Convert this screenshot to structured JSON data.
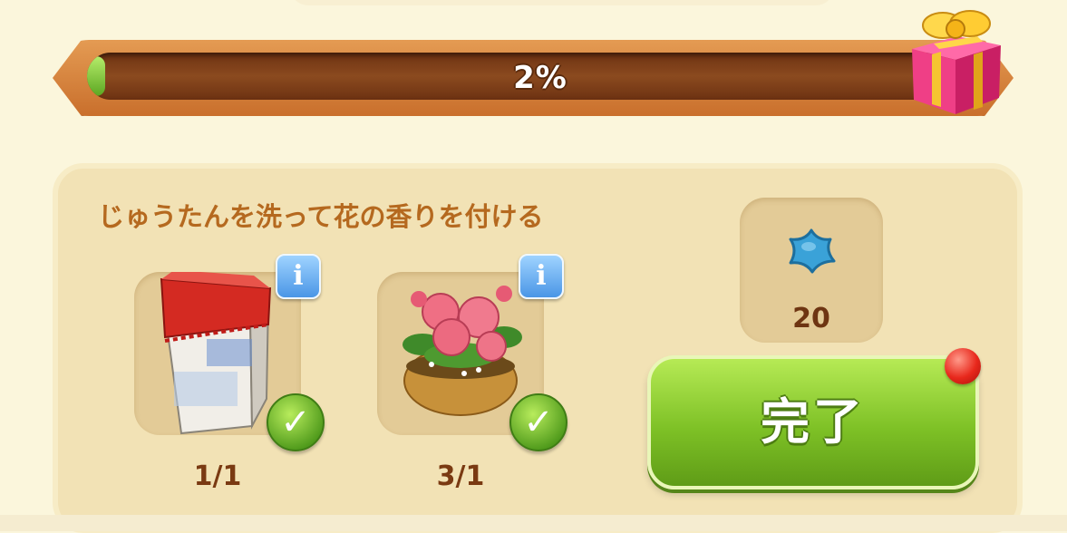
{
  "progress": {
    "label": "2%",
    "value": 0.02
  },
  "task": {
    "title": "じゅうたんを洗って花の香りを付ける",
    "items": [
      {
        "name": "fabric-softener",
        "icon": "fabric-softener-box",
        "count": "1/1",
        "info": "i",
        "done": true
      },
      {
        "name": "peony-flowers",
        "icon": "peony-flower-pot",
        "count": "3/1",
        "info": "i",
        "done": true
      }
    ],
    "reward": {
      "icon": "blue-star-icon",
      "amount": "20"
    },
    "complete_button": {
      "label": "完了"
    }
  },
  "colors": {
    "accent_green": "#7ec126",
    "title_orange": "#b5691f",
    "count_brown": "#7a3a12",
    "notification_red": "#e8281c"
  }
}
